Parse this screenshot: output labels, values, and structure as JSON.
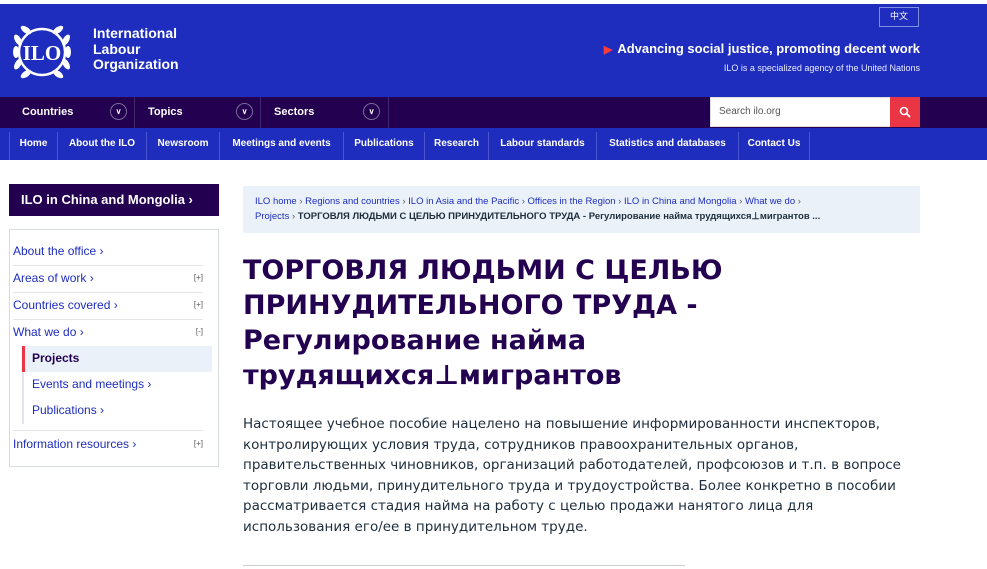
{
  "header": {
    "org_name_line1": "International",
    "org_name_line2": "Labour",
    "org_name_line3": "Organization",
    "logo_text": "ILO",
    "language_button": "中文",
    "tagline": "Advancing social justice, promoting decent work",
    "subtagline": "ILO is a specialized agency of the United Nations"
  },
  "dropdowns": {
    "countries": "Countries",
    "topics": "Topics",
    "sectors": "Sectors"
  },
  "search": {
    "placeholder": "Search ilo.org"
  },
  "mainnav": {
    "home": "Home",
    "about": "About the ILO",
    "newsroom": "Newsroom",
    "meetings": "Meetings and events",
    "publications": "Publications",
    "research": "Research",
    "standards": "Labour standards",
    "statistics": "Statistics and databases",
    "contact": "Contact Us"
  },
  "sidebar": {
    "heading": "ILO in China and Mongolia ›",
    "about": "About the office ›",
    "areas": "Areas of work ›",
    "countries": "Countries covered ›",
    "whatwedo": "What we do ›",
    "projects": "Projects",
    "events": "Events and meetings ›",
    "publications": "Publications ›",
    "resources": "Information resources ›",
    "expand": "[+]",
    "collapse": "[-]"
  },
  "breadcrumb": {
    "c1": "ILO home",
    "c2": "Regions and countries",
    "c3": "ILO in Asia and the Pacific",
    "c4": "Offices in the Region",
    "c5": "ILO in China and Mongolia",
    "c6": "What we do",
    "c7": "Projects",
    "current": "ТОРГОВЛЯ ЛЮДЬМИ С ЦЕЛЬЮ ПРИНУДИТЕЛЬНОГО ТРУДА - Регулирование найма трудящихся⊥мигрантов ..."
  },
  "page": {
    "title": "ТОРГОВЛЯ ЛЮДЬМИ С ЦЕЛЬЮ ПРИНУДИТЕЛЬНОГО ТРУДА - Регулирование найма трудящихся⊥мигрантов",
    "intro": "Настоящее учебное пособие нацелено на повышение информированности инспекторов, контролирующих условия труда, сотрудников правоохранительных органов, правительственных чиновников, организаций работодателей, профсоюзов и т.п. в вопросе торговли людьми, принудительного труда и трудоустройства. Более конкретно в пособии рассматривается стадия найма на работу с целью продажи нанятого лица для использования его/ее в принудительном труде."
  },
  "colors": {
    "ilo_blue": "#1e2dbe",
    "ilo_purple": "#230050",
    "accent_red": "#ea3545",
    "pale_blue": "#eaf1f8"
  },
  "icons": {
    "logo": "ilo-logo-icon",
    "chevron": "chevron-down-icon",
    "search": "search-icon",
    "tagline_arrow": "triangle-right-icon"
  }
}
